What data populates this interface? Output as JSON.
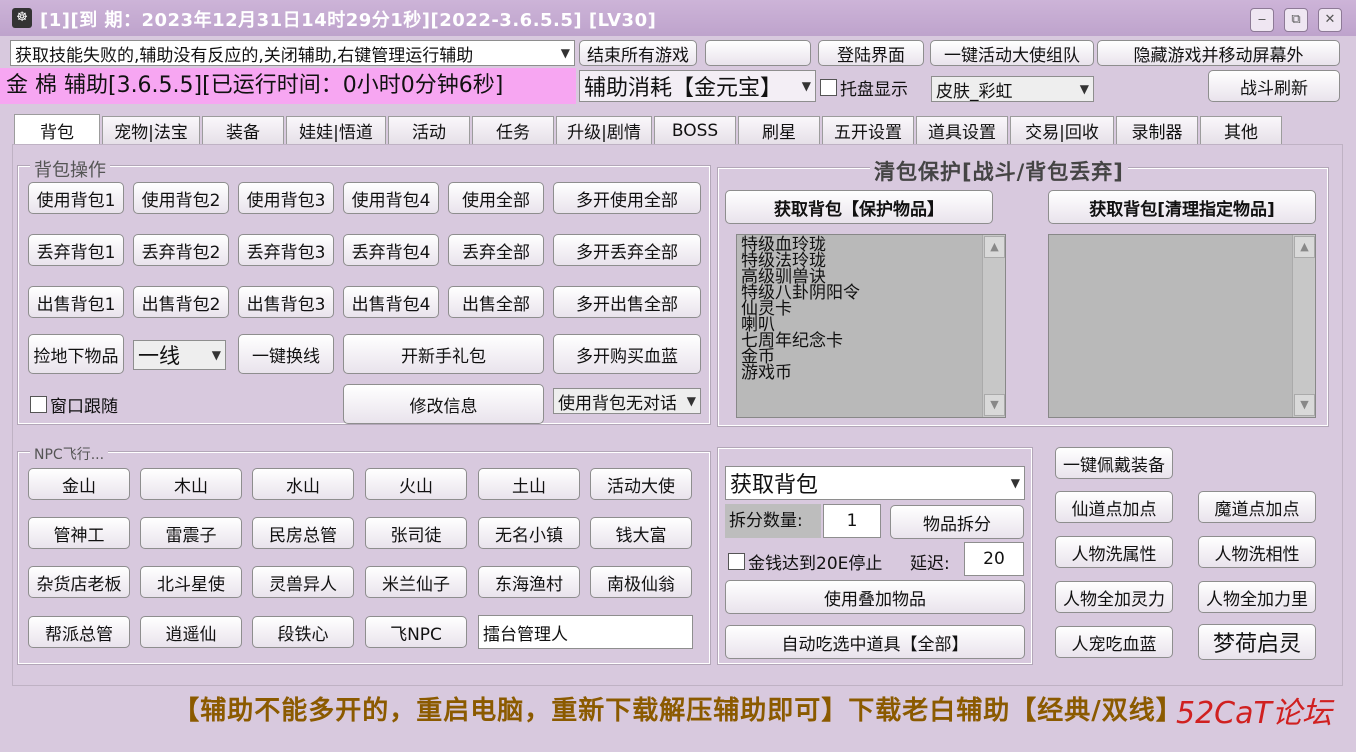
{
  "window": {
    "title": "[1][到 期：2023年12月31日14时29分1秒][2022-3.6.5.5] [LV30]",
    "icon_char": "☸",
    "min_icon": "‒",
    "restore_icon": "⧉",
    "close_icon": "✕"
  },
  "toolbar": {
    "notice_select": "获取技能失败的,辅助没有反应的,关闭辅助,右键管理运行辅助",
    "end_all_games": "结束所有游戏",
    "blank_button": "",
    "login_screen": "登陆界面",
    "one_key_ambassador": "一键活动大使组队",
    "hide_game": "隐藏游戏并移动屏幕外",
    "status_banner": "金 棉 辅助[3.6.5.5][已运行时间：0小时0分钟6秒]",
    "consume_select": "辅助消耗【金元宝】",
    "tray_display": "托盘显示",
    "skin_select": "皮肤_彩虹",
    "battle_refresh": "战斗刷新"
  },
  "tabs": [
    "背包",
    "宠物|法宝",
    "装备",
    "娃娃|悟道",
    "活动",
    "任务",
    "升级|剧情",
    "BOSS",
    "刷星",
    "五开设置",
    "道具设置",
    "交易|回收",
    "录制器",
    "其他"
  ],
  "bag_ops": {
    "title": "背包操作",
    "use": [
      "使用背包1",
      "使用背包2",
      "使用背包3",
      "使用背包4",
      "使用全部",
      "多开使用全部"
    ],
    "discard": [
      "丢弃背包1",
      "丢弃背包2",
      "丢弃背包3",
      "丢弃背包4",
      "丢弃全部",
      "多开丢弃全部"
    ],
    "sell": [
      "出售背包1",
      "出售背包2",
      "出售背包3",
      "出售背包4",
      "出售全部",
      "多开出售全部"
    ],
    "pick_ground": "捡地下物品",
    "line_select": "一线",
    "switch_line": "一键换线",
    "open_gift": "开新手礼包",
    "multi_buy": "多开购买血蓝",
    "window_follow": "窗口跟随",
    "edit_info": "修改信息",
    "use_bag_select": "使用背包无对话"
  },
  "npc": {
    "title": "NPC飞行...",
    "row1": [
      "金山",
      "木山",
      "水山",
      "火山",
      "土山",
      "活动大使"
    ],
    "row2": [
      "管神工",
      "雷震子",
      "民房总管",
      "张司徒",
      "无名小镇",
      "钱大富"
    ],
    "row3": [
      "杂货店老板",
      "北斗星使",
      "灵兽异人",
      "米兰仙子",
      "东海渔村",
      "南极仙翁"
    ],
    "row4": [
      "帮派总管",
      "逍遥仙",
      "段铁心",
      "飞NPC"
    ],
    "custom_npc": "擂台管理人"
  },
  "protect": {
    "title": "清包保护[战斗/背包丢弃]",
    "get_protect": "获取背包【保护物品】",
    "get_clear": "获取背包[清理指定物品]",
    "items": [
      "特级血玲珑",
      "特级法玲珑",
      "高级驯兽诀",
      "特级八卦阴阳令",
      "仙灵卡",
      "喇叭",
      "七周年纪念卡",
      "金币",
      "游戏币"
    ]
  },
  "split": {
    "select": "获取背包",
    "count_label": "拆分数量:",
    "count_value": "1",
    "split_button": "物品拆分",
    "stop_check": "金钱达到20E停止",
    "delay_label": "延迟:",
    "delay_value": "20",
    "use_stack": "使用叠加物品",
    "auto_eat": "自动吃选中道具【全部】"
  },
  "right_buttons": {
    "equip_all": "一键佩戴装备",
    "xian_points": "仙道点加点",
    "mo_points": "魔道点加点",
    "wash_attr": "人物洗属性",
    "wash_phase": "人物洗相性",
    "add_spirit": "人物全加灵力",
    "add_power": "人物全加力里",
    "pet_hp": "人宠吃血蓝",
    "menghe": "梦荷启灵"
  },
  "footer": {
    "notice": "【辅助不能多开的，重启电脑，重新下载解压辅助即可】下载老白辅助【经典/双线】",
    "watermark": "52CaT论坛"
  }
}
